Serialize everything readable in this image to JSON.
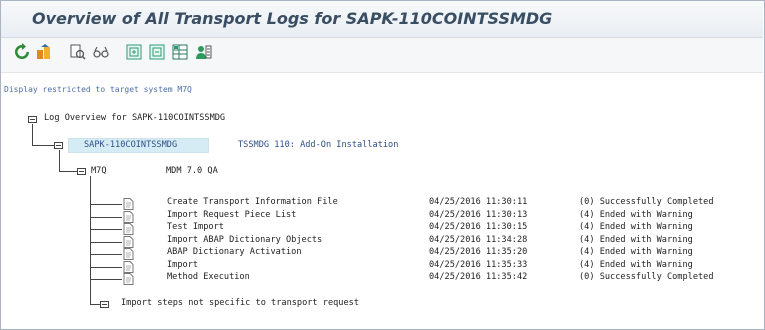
{
  "title": "Overview of All Transport Logs for SAPK-110COINTSSMDG",
  "toolbar": {
    "icons": [
      "refresh-icon",
      "transport-icon",
      "find-icon",
      "glasses-icon",
      "expand-icon",
      "collapse-icon",
      "layout-icon",
      "user-icon"
    ]
  },
  "restriction_text": "Display restricted to target system M7Q",
  "tree": {
    "root_label": "Log Overview for SAPK-110COINTSSMDG",
    "request": {
      "id": "SAPK-110COINTSSMDG",
      "description": "TSSMDG 110: Add-On Installation"
    },
    "system": {
      "id": "M7Q",
      "description": "MDM 7.0 QA"
    },
    "steps": [
      {
        "name": "Create Transport Information File",
        "datetime": "04/25/2016 11:30:11",
        "status": "(0) Successfully Completed"
      },
      {
        "name": "Import Request Piece List",
        "datetime": "04/25/2016 11:30:13",
        "status": "(4) Ended with Warning"
      },
      {
        "name": "Test Import",
        "datetime": "04/25/2016 11:30:15",
        "status": "(4) Ended with Warning"
      },
      {
        "name": "Import ABAP Dictionary Objects",
        "datetime": "04/25/2016 11:34:28",
        "status": "(4) Ended with Warning"
      },
      {
        "name": "ABAP Dictionary Activation",
        "datetime": "04/25/2016 11:35:20",
        "status": "(4) Ended with Warning"
      },
      {
        "name": "Import",
        "datetime": "04/25/2016 11:35:33",
        "status": "(4) Ended with Warning"
      },
      {
        "name": "Method Execution",
        "datetime": "04/25/2016 11:35:42",
        "status": "(0) Successfully Completed"
      }
    ],
    "other_steps_label": "Import steps not specific to transport request"
  }
}
